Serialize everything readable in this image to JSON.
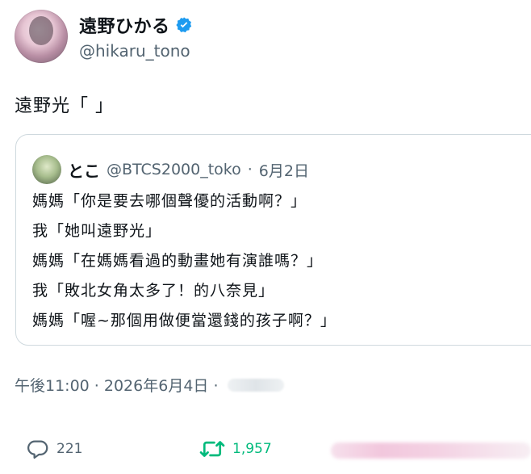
{
  "author": {
    "display_name": "遠野ひかる",
    "handle": "@hikaru_tono",
    "verified_icon": "verified-badge-icon"
  },
  "tweet": {
    "text": "遠野光「 」"
  },
  "quoted_tweet": {
    "display_name": "とこ",
    "handle": "@BTCS2000_toko",
    "separator": "·",
    "date": "6月2日",
    "lines": [
      "媽媽「你是要去哪個聲優的活動啊？」",
      "我「她叫遠野光」",
      "媽媽「在媽媽看過的動畫她有演誰嗎？」",
      "我「敗北女角太多了！的八奈見」",
      "媽媽「喔~那個用做便當還錢的孩子啊？」"
    ]
  },
  "meta": {
    "timestamp": "午後11:00 · 2026年6月4日 ·"
  },
  "actions": {
    "reply_count": "221",
    "retweet_count": "1,957"
  },
  "colors": {
    "verified": "#1d9bf0",
    "retweet": "#00ba7c",
    "secondary_text": "#536471",
    "border": "#cfd9de"
  }
}
